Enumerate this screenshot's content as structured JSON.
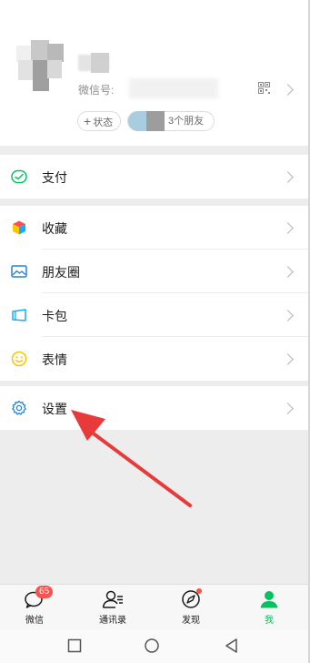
{
  "profile": {
    "wechat_id_label": "微信号:",
    "status_button": "状态",
    "status_plus": "+",
    "friends_count": "3个朋友"
  },
  "menu": {
    "pay": "支付",
    "favorites": "收藏",
    "moments": "朋友圈",
    "cards": "卡包",
    "stickers": "表情",
    "settings": "设置"
  },
  "tabbar": {
    "chats": "微信",
    "chats_badge": "65",
    "contacts": "通讯录",
    "discover": "发现",
    "me": "我"
  },
  "colors": {
    "accent": "#07c160",
    "badge": "#fa5151",
    "annotation_arrow": "#e83a3a"
  },
  "icons": {
    "pay": "pay-icon",
    "favorites": "cube-icon",
    "moments": "picture-icon",
    "cards": "card-wallet-icon",
    "stickers": "smiley-icon",
    "settings": "gear-icon"
  }
}
